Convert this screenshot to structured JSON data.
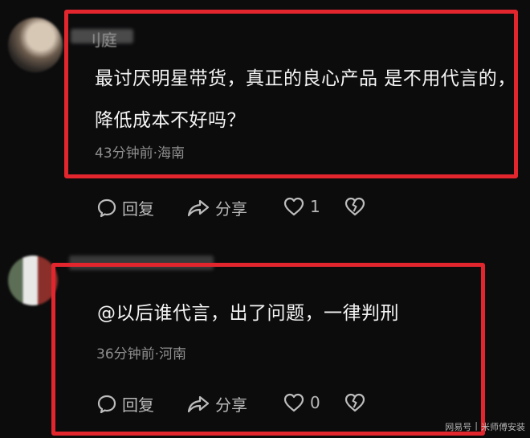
{
  "comments": [
    {
      "username": "刂庭",
      "text": "最讨厌明星带货，真正的良心产品 是不用代言的，降低成本不好吗？",
      "meta": "43分钟前·海南",
      "reply_label": "回复",
      "share_label": "分享",
      "like_count": "1"
    },
    {
      "username": "",
      "text": "@以后谁代言，出了问题，一律判刑",
      "meta": "36分钟前·河南",
      "reply_label": "回复",
      "share_label": "分享",
      "like_count": "0"
    }
  ],
  "watermark": {
    "source": "网易号",
    "account": "米师傅安装"
  },
  "colors": {
    "highlight": "#e3262e",
    "background": "#0c0c0d"
  },
  "icons": [
    "reply-icon",
    "share-icon",
    "heart-icon",
    "broken-heart-icon"
  ]
}
